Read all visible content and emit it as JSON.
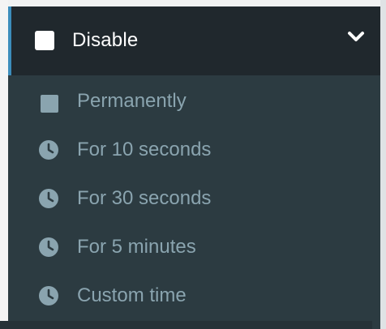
{
  "dropdown": {
    "header": {
      "label": "Disable",
      "checkbox_icon": "checkbox-icon",
      "chevron_icon": "chevron-down-icon"
    },
    "items": [
      {
        "label": "Permanently",
        "icon": "square-icon"
      },
      {
        "label": "For 10 seconds",
        "icon": "clock-icon"
      },
      {
        "label": "For 30 seconds",
        "icon": "clock-icon"
      },
      {
        "label": "For 5 minutes",
        "icon": "clock-icon"
      },
      {
        "label": "Custom time",
        "icon": "clock-icon"
      }
    ]
  },
  "colors": {
    "header_bg": "#20282d",
    "submenu_bg": "#2c3b41",
    "accent": "#3c8dbc",
    "item_text": "#8aa4af",
    "header_text": "#ffffff"
  }
}
